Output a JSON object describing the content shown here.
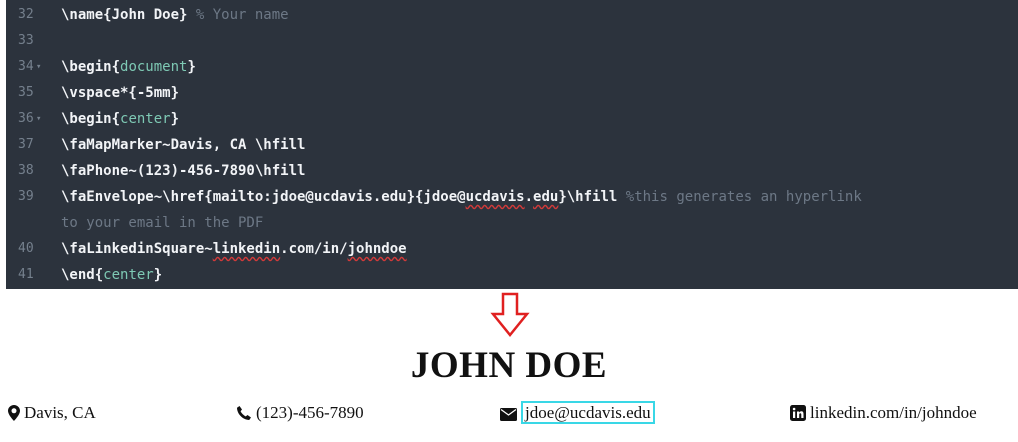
{
  "editor": {
    "lines": [
      {
        "num": "32",
        "fold": "",
        "parts": [
          {
            "t": "\\name",
            "c": "kw"
          },
          {
            "t": "{John Doe} ",
            "c": "kw"
          },
          {
            "t": "% Your name",
            "c": "cmt"
          }
        ]
      },
      {
        "num": "33",
        "fold": "",
        "parts": []
      },
      {
        "num": "34",
        "fold": "▾",
        "parts": [
          {
            "t": "\\begin{",
            "c": "kw"
          },
          {
            "t": "document",
            "c": "arg"
          },
          {
            "t": "}",
            "c": "kw"
          }
        ]
      },
      {
        "num": "35",
        "fold": "",
        "parts": [
          {
            "t": "\\vspace*{-5mm}",
            "c": "kw"
          }
        ]
      },
      {
        "num": "36",
        "fold": "▾",
        "parts": [
          {
            "t": "\\begin{",
            "c": "kw"
          },
          {
            "t": "center",
            "c": "arg"
          },
          {
            "t": "}",
            "c": "kw"
          }
        ]
      },
      {
        "num": "37",
        "fold": "",
        "parts": [
          {
            "t": "\\faMapMarker~Davis, CA \\hfill",
            "c": "kw"
          }
        ]
      },
      {
        "num": "38",
        "fold": "",
        "parts": [
          {
            "t": "\\faPhone~(123)-456-7890\\hfill",
            "c": "kw"
          }
        ]
      },
      {
        "num": "39",
        "fold": "",
        "parts": [
          {
            "t": "\\faEnvelope~\\href{mailto:jdoe@ucdavis.edu}{jdoe@",
            "c": "kw"
          },
          {
            "t": "ucdavis",
            "c": "kw sq"
          },
          {
            "t": ".",
            "c": "kw"
          },
          {
            "t": "edu",
            "c": "kw sq"
          },
          {
            "t": "}\\hfill ",
            "c": "kw"
          },
          {
            "t": "%this generates an hyperlink",
            "c": "cmt"
          }
        ]
      },
      {
        "num": "",
        "fold": "",
        "parts": [
          {
            "t": "to your email in the PDF",
            "c": "cmt"
          }
        ]
      },
      {
        "num": "40",
        "fold": "",
        "parts": [
          {
            "t": "\\faLinkedinSquare~",
            "c": "kw"
          },
          {
            "t": "linkedin",
            "c": "kw sq"
          },
          {
            "t": ".com/in/",
            "c": "kw"
          },
          {
            "t": "johndoe",
            "c": "kw sq"
          }
        ]
      },
      {
        "num": "41",
        "fold": "",
        "parts": [
          {
            "t": "\\end{",
            "c": "kw"
          },
          {
            "t": "center",
            "c": "arg"
          },
          {
            "t": "}",
            "c": "kw"
          }
        ]
      }
    ]
  },
  "arrow_icon": "down-arrow-icon",
  "preview": {
    "name": "JOHN DOE",
    "location": "Davis, CA",
    "phone": "(123)-456-7890",
    "email": "jdoe@ucdavis.edu",
    "linkedin": "linkedin.com/in/johndoe"
  },
  "colors": {
    "editor_bg": "#2c333d",
    "arrow": "#e02020",
    "link_border": "#39d7e6"
  }
}
